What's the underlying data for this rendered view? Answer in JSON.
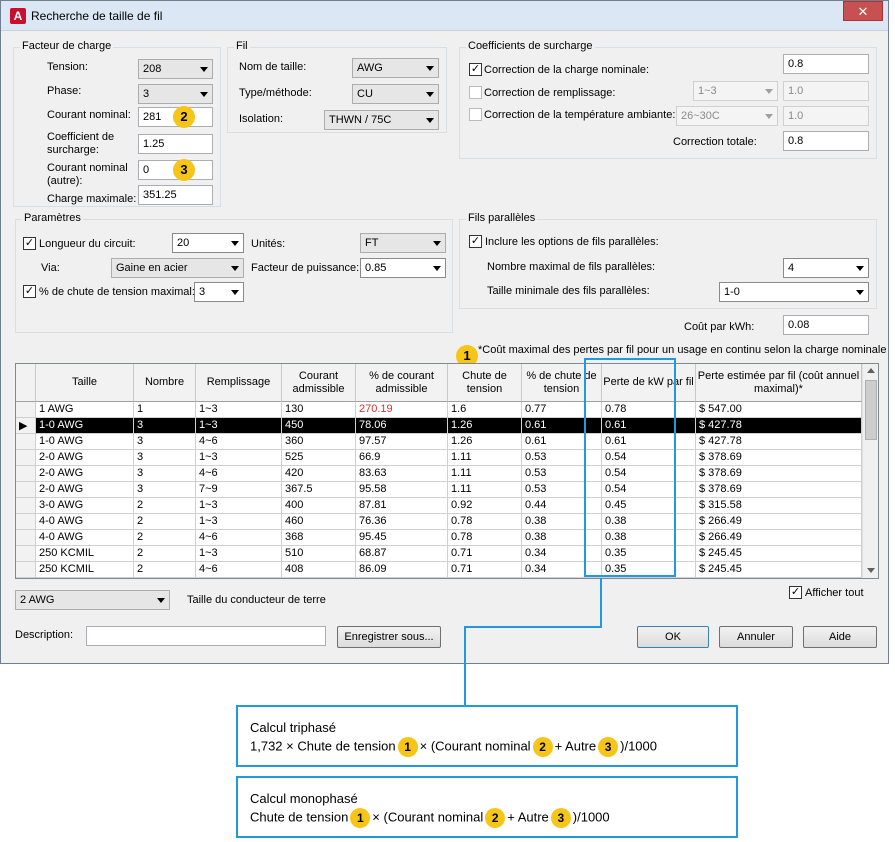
{
  "window": {
    "title": "Recherche de taille de fil",
    "close_symbol": "✕"
  },
  "load_factor": {
    "legend": "Facteur de charge",
    "voltage_label": "Tension:",
    "voltage_value": "208",
    "phase_label": "Phase:",
    "phase_value": "3",
    "rated_current_label": "Courant nominal:",
    "rated_current_value": "281",
    "overload_coef_label": "Coefficient de surcharge:",
    "overload_coef_value": "1.25",
    "other_current_label": "Courant nominal (autre):",
    "other_current_value": "0",
    "max_load_label": "Charge maximale:",
    "max_load_value": "351.25"
  },
  "wire": {
    "legend": "Fil",
    "size_name_label": "Nom de taille:",
    "size_name_value": "AWG",
    "type_label": "Type/méthode:",
    "type_value": "CU",
    "insulation_label": "Isolation:",
    "insulation_value": "THWN / 75C"
  },
  "overload": {
    "legend": "Coefficients de surcharge",
    "nominal_label": "Correction de la charge nominale:",
    "nominal_value": "0.8",
    "nominal_checked": "✓",
    "fill_label": "Correction de remplissage:",
    "fill_combo": "1~3",
    "fill_value": "1.0",
    "temp_label": "Correction de la température ambiante:",
    "temp_combo": "26~30C",
    "temp_value": "1.0",
    "total_label": "Correction totale:",
    "total_value": "0.8"
  },
  "params": {
    "legend": "Paramètres",
    "length_label": "Longueur du circuit:",
    "length_value": "20",
    "length_checked": "✓",
    "units_label": "Unités:",
    "units_value": "FT",
    "via_label": "Via:",
    "via_value": "Gaine en acier",
    "pf_label": "Facteur de puissance:",
    "pf_value": "0.85",
    "vdrop_label": "% de chute de tension maximal:",
    "vdrop_value": "3",
    "vdrop_checked": "✓"
  },
  "parallel": {
    "legend": "Fils parallèles",
    "include_label": "Inclure les options de fils parallèles:",
    "include_checked": "✓",
    "max_label": "Nombre maximal de fils parallèles:",
    "max_value": "4",
    "min_size_label": "Taille minimale des fils parallèles:",
    "min_size_value": "1-0"
  },
  "cost": {
    "label": "Coût par kWh:",
    "value": "0.08"
  },
  "footnote": "*Coût maximal des pertes par fil pour un usage en continu selon la charge nominale",
  "table": {
    "headers": [
      "Taille",
      "Nombre",
      "Remplissage",
      "Courant admissible",
      "% de courant admissible",
      "Chute de tension",
      "% de chute de tension",
      "Perte de kW par fil",
      "Perte estimée par fil (coût annuel maximal)*"
    ],
    "rows": [
      [
        "1 AWG",
        "1",
        "1~3",
        "130",
        "270.19",
        "1.6",
        "0.77",
        "0.78",
        "$ 547.00"
      ],
      [
        "1-0 AWG",
        "3",
        "1~3",
        "450",
        "78.06",
        "1.26",
        "0.61",
        "0.61",
        "$ 427.78"
      ],
      [
        "1-0 AWG",
        "3",
        "4~6",
        "360",
        "97.57",
        "1.26",
        "0.61",
        "0.61",
        "$ 427.78"
      ],
      [
        "2-0 AWG",
        "3",
        "1~3",
        "525",
        "66.9",
        "1.11",
        "0.53",
        "0.54",
        "$ 378.69"
      ],
      [
        "2-0 AWG",
        "3",
        "4~6",
        "420",
        "83.63",
        "1.11",
        "0.53",
        "0.54",
        "$ 378.69"
      ],
      [
        "2-0 AWG",
        "3",
        "7~9",
        "367.5",
        "95.58",
        "1.11",
        "0.53",
        "0.54",
        "$ 378.69"
      ],
      [
        "3-0 AWG",
        "2",
        "1~3",
        "400",
        "87.81",
        "0.92",
        "0.44",
        "0.45",
        "$ 315.58"
      ],
      [
        "4-0 AWG",
        "2",
        "1~3",
        "460",
        "76.36",
        "0.78",
        "0.38",
        "0.38",
        "$ 266.49"
      ],
      [
        "4-0 AWG",
        "2",
        "4~6",
        "368",
        "95.45",
        "0.78",
        "0.38",
        "0.38",
        "$ 266.49"
      ],
      [
        "250 KCMIL",
        "2",
        "1~3",
        "510",
        "68.87",
        "0.71",
        "0.34",
        "0.35",
        "$ 245.45"
      ],
      [
        "250 KCMIL",
        "2",
        "4~6",
        "408",
        "86.09",
        "0.71",
        "0.34",
        "0.35",
        "$ 245.45"
      ]
    ],
    "selected_row": 1,
    "row_marker": "▶",
    "overload_color": "#e03030"
  },
  "ground": {
    "value": "2 AWG",
    "label": "Taille du conducteur de terre"
  },
  "show_all": {
    "label": "Afficher tout",
    "checked": "✓"
  },
  "description": {
    "label": "Description:",
    "value": ""
  },
  "buttons": {
    "save_as": "Enregistrer sous...",
    "ok": "OK",
    "cancel": "Annuler",
    "help": "Aide"
  },
  "badges": {
    "one": "1",
    "two": "2",
    "three": "3"
  },
  "calc_three_phase": {
    "title": "Calcul triphasé",
    "prefix": "1,732 × Chute de tension",
    "mid1": "× (Courant nominal",
    "mid2": "+ Autre",
    "suffix": ")/1000"
  },
  "calc_single_phase": {
    "title": "Calcul monophasé",
    "prefix": "Chute de tension",
    "mid1": "× (Courant nominal",
    "mid2": "+ Autre",
    "suffix": ")/1000"
  },
  "accent_color": "#1f9ae0",
  "badge_color": "#f6c518"
}
